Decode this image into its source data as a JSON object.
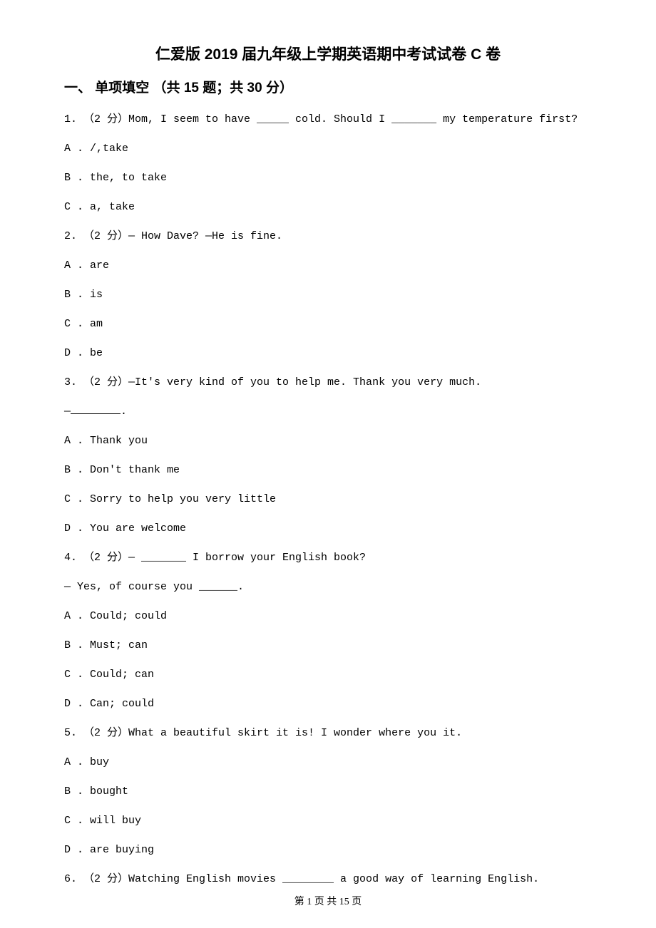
{
  "title": "仁爱版 2019 届九年级上学期英语期中考试试卷 C 卷",
  "section_header": "一、 单项填空 （共 15 题；共 30 分）",
  "q1": {
    "text": "1. （2 分）Mom, I seem to have _____ cold. Should I _______ my temperature first?",
    "a": "A . /,take",
    "b": "B . the, to take",
    "c": "C . a, take"
  },
  "q2": {
    "text": "2. （2 分）— How           Dave? —He is fine.",
    "a": "A . are",
    "b": "B . is",
    "c": "C . am",
    "d": "D . be"
  },
  "q3": {
    "text": "3. （2 分）—It's very kind of you to help me. Thank you very much.",
    "line2_prefix": "—",
    "line2_suffix": ".",
    "a": "A . Thank you",
    "b": "B . Don't thank me",
    "c": "C . Sorry to help you very little",
    "d": "D . You are welcome"
  },
  "q4": {
    "text": "4. （2 分）— _______ I borrow your English book?",
    "line2": "— Yes, of course you ______.",
    "a": "A . Could; could",
    "b": "B . Must; can",
    "c": "C . Could; can",
    "d": "D . Can; could"
  },
  "q5": {
    "text": "5. （2 分）What a beautiful skirt it is! I wonder where you            it.",
    "a": "A . buy",
    "b": "B . bought",
    "c": "C . will buy",
    "d": "D . are buying"
  },
  "q6": {
    "text": "6. （2 分）Watching English movies ________ a good way of learning English."
  },
  "footer": "第 1 页 共 15 页"
}
